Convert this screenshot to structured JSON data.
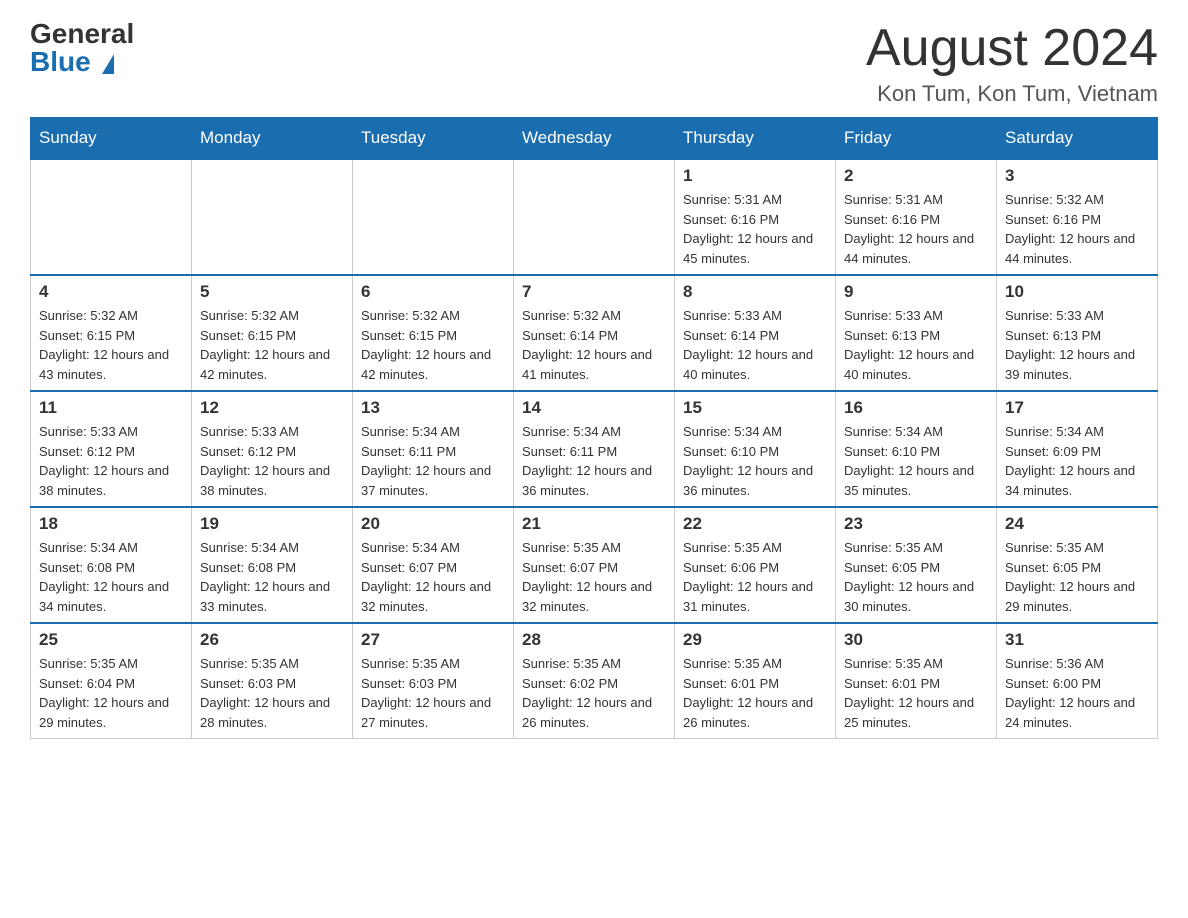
{
  "header": {
    "logo_general": "General",
    "logo_blue": "Blue",
    "month_title": "August 2024",
    "location": "Kon Tum, Kon Tum, Vietnam"
  },
  "days_of_week": [
    "Sunday",
    "Monday",
    "Tuesday",
    "Wednesday",
    "Thursday",
    "Friday",
    "Saturday"
  ],
  "weeks": [
    [
      {
        "day": "",
        "info": ""
      },
      {
        "day": "",
        "info": ""
      },
      {
        "day": "",
        "info": ""
      },
      {
        "day": "",
        "info": ""
      },
      {
        "day": "1",
        "info": "Sunrise: 5:31 AM\nSunset: 6:16 PM\nDaylight: 12 hours and 45 minutes."
      },
      {
        "day": "2",
        "info": "Sunrise: 5:31 AM\nSunset: 6:16 PM\nDaylight: 12 hours and 44 minutes."
      },
      {
        "day": "3",
        "info": "Sunrise: 5:32 AM\nSunset: 6:16 PM\nDaylight: 12 hours and 44 minutes."
      }
    ],
    [
      {
        "day": "4",
        "info": "Sunrise: 5:32 AM\nSunset: 6:15 PM\nDaylight: 12 hours and 43 minutes."
      },
      {
        "day": "5",
        "info": "Sunrise: 5:32 AM\nSunset: 6:15 PM\nDaylight: 12 hours and 42 minutes."
      },
      {
        "day": "6",
        "info": "Sunrise: 5:32 AM\nSunset: 6:15 PM\nDaylight: 12 hours and 42 minutes."
      },
      {
        "day": "7",
        "info": "Sunrise: 5:32 AM\nSunset: 6:14 PM\nDaylight: 12 hours and 41 minutes."
      },
      {
        "day": "8",
        "info": "Sunrise: 5:33 AM\nSunset: 6:14 PM\nDaylight: 12 hours and 40 minutes."
      },
      {
        "day": "9",
        "info": "Sunrise: 5:33 AM\nSunset: 6:13 PM\nDaylight: 12 hours and 40 minutes."
      },
      {
        "day": "10",
        "info": "Sunrise: 5:33 AM\nSunset: 6:13 PM\nDaylight: 12 hours and 39 minutes."
      }
    ],
    [
      {
        "day": "11",
        "info": "Sunrise: 5:33 AM\nSunset: 6:12 PM\nDaylight: 12 hours and 38 minutes."
      },
      {
        "day": "12",
        "info": "Sunrise: 5:33 AM\nSunset: 6:12 PM\nDaylight: 12 hours and 38 minutes."
      },
      {
        "day": "13",
        "info": "Sunrise: 5:34 AM\nSunset: 6:11 PM\nDaylight: 12 hours and 37 minutes."
      },
      {
        "day": "14",
        "info": "Sunrise: 5:34 AM\nSunset: 6:11 PM\nDaylight: 12 hours and 36 minutes."
      },
      {
        "day": "15",
        "info": "Sunrise: 5:34 AM\nSunset: 6:10 PM\nDaylight: 12 hours and 36 minutes."
      },
      {
        "day": "16",
        "info": "Sunrise: 5:34 AM\nSunset: 6:10 PM\nDaylight: 12 hours and 35 minutes."
      },
      {
        "day": "17",
        "info": "Sunrise: 5:34 AM\nSunset: 6:09 PM\nDaylight: 12 hours and 34 minutes."
      }
    ],
    [
      {
        "day": "18",
        "info": "Sunrise: 5:34 AM\nSunset: 6:08 PM\nDaylight: 12 hours and 34 minutes."
      },
      {
        "day": "19",
        "info": "Sunrise: 5:34 AM\nSunset: 6:08 PM\nDaylight: 12 hours and 33 minutes."
      },
      {
        "day": "20",
        "info": "Sunrise: 5:34 AM\nSunset: 6:07 PM\nDaylight: 12 hours and 32 minutes."
      },
      {
        "day": "21",
        "info": "Sunrise: 5:35 AM\nSunset: 6:07 PM\nDaylight: 12 hours and 32 minutes."
      },
      {
        "day": "22",
        "info": "Sunrise: 5:35 AM\nSunset: 6:06 PM\nDaylight: 12 hours and 31 minutes."
      },
      {
        "day": "23",
        "info": "Sunrise: 5:35 AM\nSunset: 6:05 PM\nDaylight: 12 hours and 30 minutes."
      },
      {
        "day": "24",
        "info": "Sunrise: 5:35 AM\nSunset: 6:05 PM\nDaylight: 12 hours and 29 minutes."
      }
    ],
    [
      {
        "day": "25",
        "info": "Sunrise: 5:35 AM\nSunset: 6:04 PM\nDaylight: 12 hours and 29 minutes."
      },
      {
        "day": "26",
        "info": "Sunrise: 5:35 AM\nSunset: 6:03 PM\nDaylight: 12 hours and 28 minutes."
      },
      {
        "day": "27",
        "info": "Sunrise: 5:35 AM\nSunset: 6:03 PM\nDaylight: 12 hours and 27 minutes."
      },
      {
        "day": "28",
        "info": "Sunrise: 5:35 AM\nSunset: 6:02 PM\nDaylight: 12 hours and 26 minutes."
      },
      {
        "day": "29",
        "info": "Sunrise: 5:35 AM\nSunset: 6:01 PM\nDaylight: 12 hours and 26 minutes."
      },
      {
        "day": "30",
        "info": "Sunrise: 5:35 AM\nSunset: 6:01 PM\nDaylight: 12 hours and 25 minutes."
      },
      {
        "day": "31",
        "info": "Sunrise: 5:36 AM\nSunset: 6:00 PM\nDaylight: 12 hours and 24 minutes."
      }
    ]
  ]
}
